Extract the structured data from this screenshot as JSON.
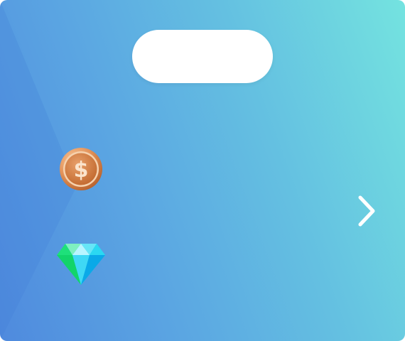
{
  "reward_card": {
    "title_label": "",
    "icons": {
      "coin": "coin-icon",
      "gem": "diamond-icon",
      "next": "chevron-right-icon"
    },
    "colors": {
      "gradient_start": "#74e3e0",
      "gradient_end": "#4f8ade",
      "coin": "#d9894a",
      "gem_cyan": "#22d3f0",
      "gem_green": "#1ee07a",
      "pill": "#ffffff"
    }
  }
}
